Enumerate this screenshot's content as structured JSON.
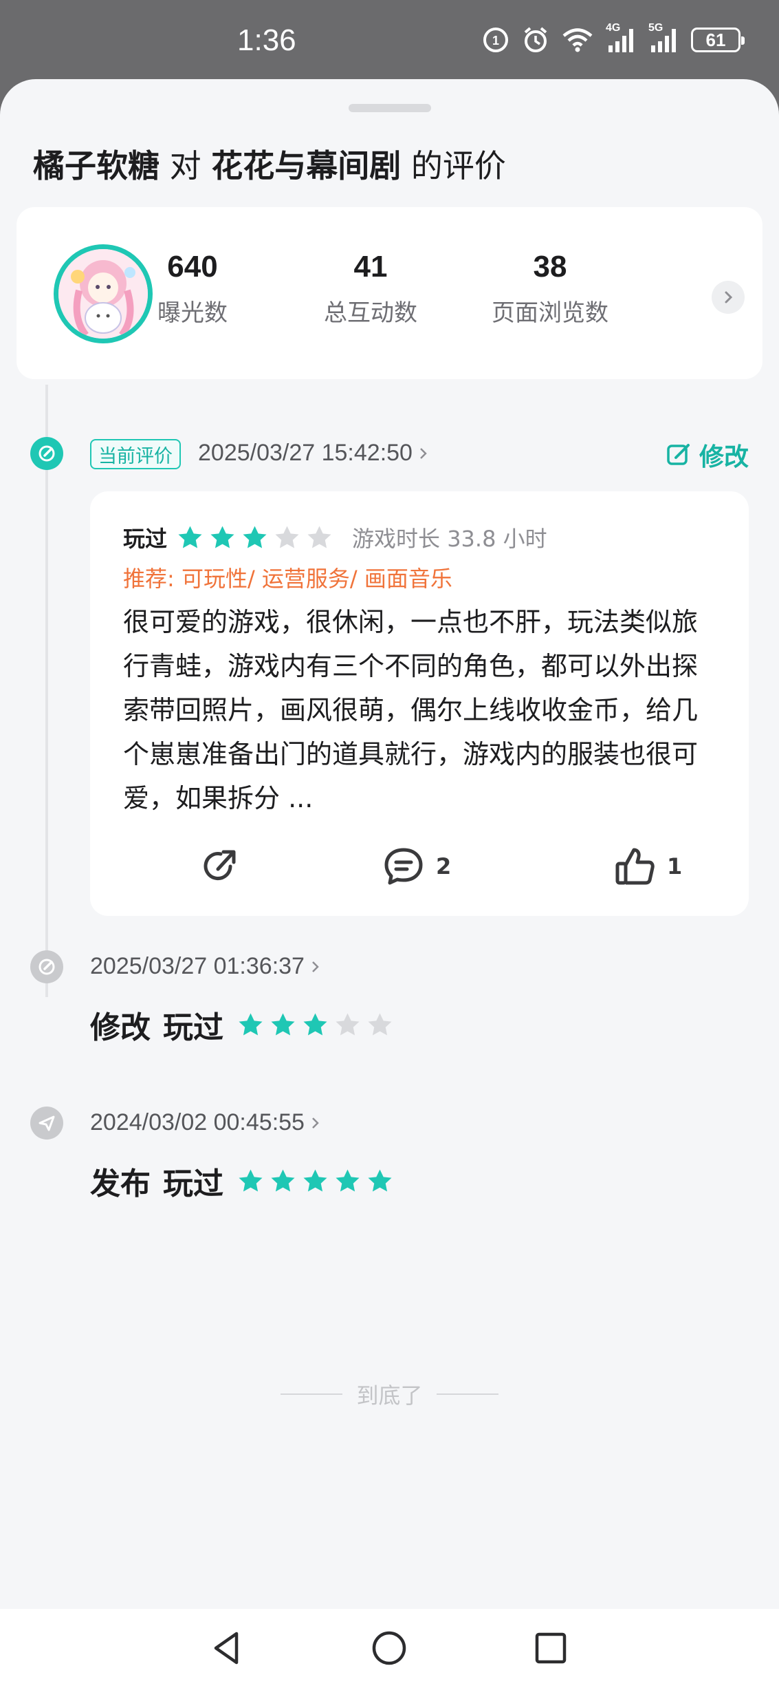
{
  "status_bar": {
    "time": "1:36",
    "network_4g": "4G",
    "network_5g": "5G",
    "battery": "61"
  },
  "header": {
    "author": "橘子软糖",
    "connector": "对",
    "game": "花花与幕间剧",
    "suffix": "的评价"
  },
  "stats": [
    {
      "value": "640",
      "label": "曝光数"
    },
    {
      "value": "41",
      "label": "总互动数"
    },
    {
      "value": "38",
      "label": "页面浏览数"
    }
  ],
  "current_review": {
    "badge": "当前评价",
    "date": "2025/03/27 15:42:50",
    "edit_label": "修改",
    "status": "玩过",
    "rating": 3,
    "duration": "游戏时长 33.8 小时",
    "recommend": "推荐: 可玩性/ 运营服务/ 画面音乐",
    "text": "很可爱的游戏，很休闲，一点也不肝，玩法类似旅行青蛙，游戏内有三个不同的角色，都可以外出探索带回照片，画风很萌，偶尔上线收收金币，给几个崽崽准备出门的道具就行，游戏内的服装也很可爱，如果拆分 ...",
    "comment_count": "2",
    "like_count": "1"
  },
  "history": [
    {
      "date": "2025/03/27 01:36:37",
      "action": "修改",
      "status": "玩过",
      "rating": 3
    },
    {
      "date": "2024/03/02 00:45:55",
      "action": "发布",
      "status": "玩过",
      "rating": 5
    }
  ],
  "end_text": "到底了",
  "colors": {
    "accent": "#1fc7b4",
    "recommend": "#f0733a",
    "star_empty": "#d8d9dc"
  },
  "icons": {
    "alarm": "alarm-icon",
    "wifi": "wifi-icon",
    "share": "share-icon",
    "comment": "comment-icon",
    "like": "thumbs-up-icon",
    "edit": "edit-icon"
  }
}
